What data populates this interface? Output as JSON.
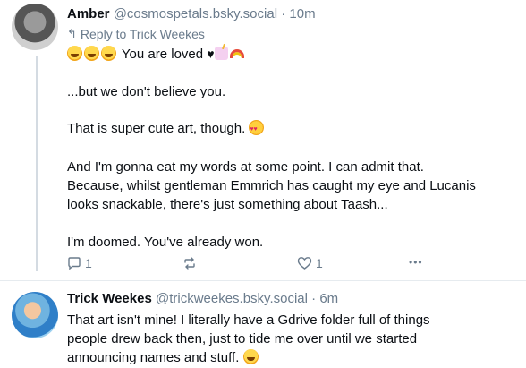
{
  "post1": {
    "author": "Amber",
    "handle": "@cosmospetals.bsky.social",
    "time": "10m",
    "reply_to": "Reply to Trick Weekes",
    "line1_text": "You are loved",
    "line1_heart": "♥",
    "lines": [
      "...but we don't believe you.",
      "That is super cute art, though.",
      "And I'm gonna eat my words at some point. I can admit that.",
      "Because, whilst gentleman Emmrich has caught my eye and Lucanis",
      "looks snackable, there's just something about Taash...",
      "I'm doomed. You've already won."
    ],
    "reply_count": "1",
    "like_count": "1",
    "more_label": "•••"
  },
  "post2": {
    "author": "Trick Weekes",
    "handle": "@trickweekes.bsky.social",
    "time": "6m",
    "lines": [
      "That art isn't mine! I literally have a Gdrive folder full of things",
      "people drew back then, just to tide me over until we started",
      "announcing names and stuff."
    ]
  },
  "separator": "·",
  "icons": {
    "reply": "reply-arrow-icon",
    "comment": "comment-icon",
    "repost": "repost-icon",
    "like": "heart-icon",
    "more": "more-icon"
  }
}
